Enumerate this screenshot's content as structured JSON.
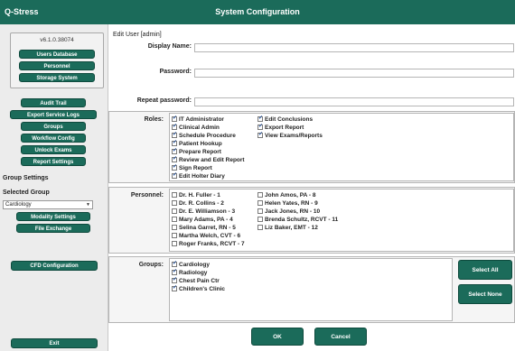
{
  "app_name": "Q-Stress",
  "window_title": "System Configuration",
  "sidebar": {
    "version": "v6.1.0.38074",
    "top_buttons": [
      "Users Database",
      "Personnel",
      "Storage System"
    ],
    "mid_buttons": [
      "Audit Trail",
      "Export Service Logs",
      "Groups",
      "Workflow Config",
      "Unlock Exams",
      "Report Settings"
    ],
    "group_settings_label": "Group Settings",
    "selected_group_label": "Selected Group",
    "selected_group_value": "Cardiology",
    "group_buttons": [
      "Modality Settings",
      "File Exchange"
    ],
    "cfd_button": "CFD Configuration",
    "exit_button": "Exit"
  },
  "main": {
    "heading": "Edit User [admin]",
    "display_name_label": "Display Name:",
    "display_name_value": "",
    "password_label": "Password:",
    "password_value": "",
    "repeat_password_label": "Repeat password:",
    "repeat_password_value": "",
    "roles_label": "Roles:",
    "roles_col1": [
      {
        "label": "IT Administrator",
        "checked": true
      },
      {
        "label": "Clinical Admin",
        "checked": true
      },
      {
        "label": "Schedule Procedure",
        "checked": true
      },
      {
        "label": "Patient Hookup",
        "checked": true
      },
      {
        "label": "Prepare Report",
        "checked": true
      },
      {
        "label": "Review and Edit Report",
        "checked": true
      },
      {
        "label": "Sign Report",
        "checked": true
      },
      {
        "label": "Edit Holter Diary",
        "checked": true
      }
    ],
    "roles_col2": [
      {
        "label": "Edit Conclusions",
        "checked": true
      },
      {
        "label": "Export Report",
        "checked": true
      },
      {
        "label": "View Exams/Reports",
        "checked": true
      }
    ],
    "personnel_label": "Personnel:",
    "personnel_col1": [
      {
        "label": "Dr. H. Fuller - 1",
        "checked": false
      },
      {
        "label": "Dr. R. Collins - 2",
        "checked": false
      },
      {
        "label": "Dr. E. Williamson - 3",
        "checked": false
      },
      {
        "label": "Mary Adams, PA - 4",
        "checked": false
      },
      {
        "label": "Selina Garret, RN - 5",
        "checked": false
      },
      {
        "label": "Martha Welch, CVT - 6",
        "checked": false
      },
      {
        "label": "Roger Franks, RCVT - 7",
        "checked": false
      }
    ],
    "personnel_col2": [
      {
        "label": "John Amos, PA - 8",
        "checked": false
      },
      {
        "label": "Helen Yates, RN - 9",
        "checked": false
      },
      {
        "label": "Jack Jones, RN - 10",
        "checked": false
      },
      {
        "label": "Brenda Schultz, RCVT - 11",
        "checked": false
      },
      {
        "label": "Liz Baker, EMT - 12",
        "checked": false
      }
    ],
    "groups_label": "Groups:",
    "groups": [
      {
        "label": "Cardiology",
        "checked": true
      },
      {
        "label": "Radiology",
        "checked": true
      },
      {
        "label": "Chest Pain Ctr",
        "checked": true
      },
      {
        "label": "Children's Clinic",
        "checked": true
      }
    ],
    "select_all_button": "Select All",
    "select_none_button": "Select None",
    "ok_button": "OK",
    "cancel_button": "Cancel"
  }
}
